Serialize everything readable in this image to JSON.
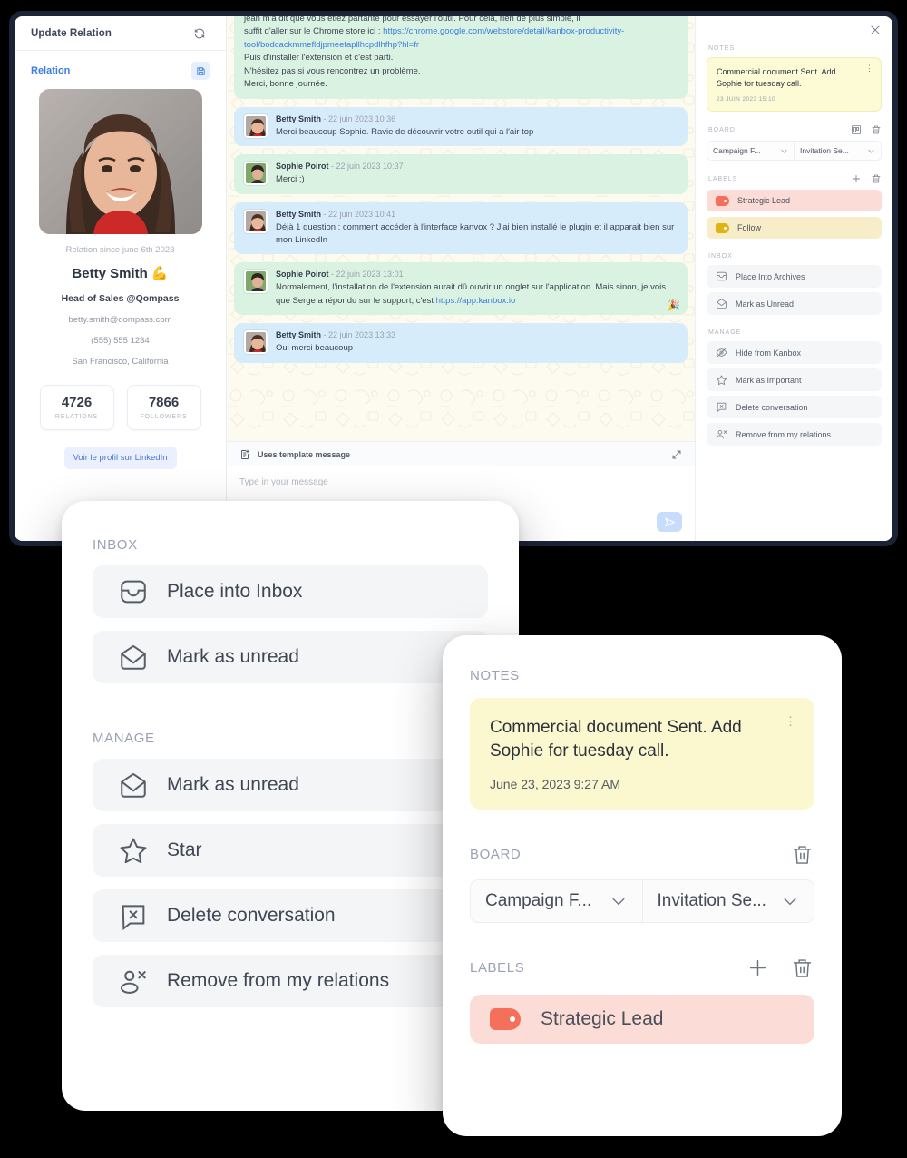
{
  "sidebar": {
    "header_title": "Update Relation",
    "refresh_icon": "refresh-icon",
    "section_title": "Relation",
    "save_icon": "save-disk-icon",
    "since": "Relation since june 6th 2023",
    "name": "Betty Smith 💪",
    "job_title": "Head of Sales @Qompass",
    "email": "betty.smith@qompass.com",
    "phone": "(555) 555 1234",
    "location": "San Francisco, California",
    "stats": [
      {
        "value": "4726",
        "label": "RELATIONS"
      },
      {
        "value": "7866",
        "label": "FOLLOWERS"
      }
    ],
    "linkedin_button": "Voir le profil sur LinkedIn"
  },
  "chat": {
    "messages": [
      {
        "direction": "in",
        "name": "",
        "time": "",
        "clipped": true,
        "lines": [
          "jean m'a dit que vous étiez partante pour essayer l'outil. Pour cela, rien de plus simple, il",
          "suffit d'aller sur le Chrome store ici : ",
          "Puis d'installer l'extension et c'est parti.",
          "N'hésitez pas si vous rencontrez un problème.",
          "Merci, bonne journée."
        ],
        "link": "https://chrome.google.com/webstore/detail/kanbox-productivity-tool/bodcackmmefldjpmeefapllhcpdlhfhp?hl=fr"
      },
      {
        "direction": "out",
        "name": "Betty Smith",
        "time": "- 22 juin 2023 10:36",
        "text": "Merci beaucoup Sophie. Ravie de découvrir votre outil qui a l'air top"
      },
      {
        "direction": "in",
        "name": "Sophie Poirot",
        "time": "- 22 juin 2023 10:37",
        "text": "Merci ;)"
      },
      {
        "direction": "out",
        "name": "Betty Smith",
        "time": "- 22 juin 2023 10:41",
        "text": "Déjà 1 question : comment accéder à l'interface kanvox ? J'ai bien installé le plugin et il apparait bien sur mon LinkedIn"
      },
      {
        "direction": "in",
        "name": "Sophie Poirot",
        "time": "- 22 juin 2023 13:01",
        "text": "Normalement, l'installation de l'extension aurait dû ouvrir un onglet sur l'application. Mais sinon, je vois que Serge a répondu sur le support, c'est ",
        "link": "https://app.kanbox.io",
        "reaction": "🎉"
      },
      {
        "direction": "out",
        "name": "Betty Smith",
        "time": "- 22 juin 2023 13:33",
        "text": "Oui merci beaucoup"
      }
    ],
    "template_label": "Uses template message",
    "template_icon": "template-document-icon",
    "expand_icon": "expand-arrows-icon",
    "composer_placeholder": "Type in your message",
    "send_icon": "send-paper-plane-icon"
  },
  "right_panel": {
    "close_icon": "close-icon",
    "notes_label": "NOTES",
    "note": {
      "text": "Commercial document Sent. Add Sophie for tuesday call.",
      "date": "23 JUIN 2023 15:10",
      "menu_icon": "more-vertical-icon"
    },
    "board_label": "BOARD",
    "board_icons": [
      "board-kanban-icon",
      "trash-icon"
    ],
    "board_selects": [
      "Campaign F...",
      "Invitation Se..."
    ],
    "labels_label": "LABELS",
    "labels_icons": [
      "plus-icon",
      "trash-icon"
    ],
    "labels": [
      {
        "text": "Strategic Lead",
        "color": "#f4705a",
        "bg": "#fbdcd6"
      },
      {
        "text": "Follow",
        "color": "#dfb411",
        "bg": "#f7edc8"
      }
    ],
    "inbox_label": "INBOX",
    "inbox_actions": [
      {
        "text": "Place Into Archives",
        "icon": "archive-icon"
      },
      {
        "text": "Mark as Unread",
        "icon": "envelope-open-icon"
      }
    ],
    "manage_label": "MANAGE",
    "manage_actions": [
      {
        "text": "Hide from Kanbox",
        "icon": "eye-off-icon"
      },
      {
        "text": "Mark as Important",
        "icon": "star-icon"
      },
      {
        "text": "Delete conversation",
        "icon": "delete-chat-icon"
      },
      {
        "text": "Remove from my relations",
        "icon": "person-remove-icon"
      }
    ]
  },
  "popup_actions": {
    "inbox_label": "INBOX",
    "inbox_items": [
      {
        "text": "Place into Inbox",
        "icon": "inbox-tray-icon"
      },
      {
        "text": "Mark as unread",
        "icon": "envelope-open-icon"
      }
    ],
    "manage_label": "MANAGE",
    "manage_items": [
      {
        "text": "Mark as unread",
        "icon": "envelope-open-icon"
      },
      {
        "text": "Star",
        "icon": "star-icon"
      },
      {
        "text": "Delete conversation",
        "icon": "delete-chat-icon"
      },
      {
        "text": "Remove from my relations",
        "icon": "person-remove-icon"
      }
    ]
  },
  "popup_details": {
    "notes_label": "NOTES",
    "note": {
      "text": "Commercial document Sent. Add Sophie for tuesday call.",
      "date": "June 23, 2023 9:27 AM",
      "menu_icon": "more-vertical-icon"
    },
    "board_label": "BOARD",
    "board_trash_icon": "trash-icon",
    "board_selects": [
      "Campaign F...",
      "Invitation Se..."
    ],
    "labels_label": "LABELS",
    "labels_plus_icon": "plus-icon",
    "labels_trash_icon": "trash-icon",
    "label": {
      "text": "Strategic Lead",
      "color": "#f4705a",
      "bg": "#fbdcd6"
    }
  },
  "colors": {
    "bezel": "#1b2436",
    "accent_blue": "#3b7de0",
    "bubble_in": "#d9f2e2",
    "bubble_out": "#d7ecfa",
    "note_yellow": "#fcfbd6",
    "label_red": "#f4705a",
    "label_yellow": "#dfb411",
    "page_bg": "#000000"
  }
}
